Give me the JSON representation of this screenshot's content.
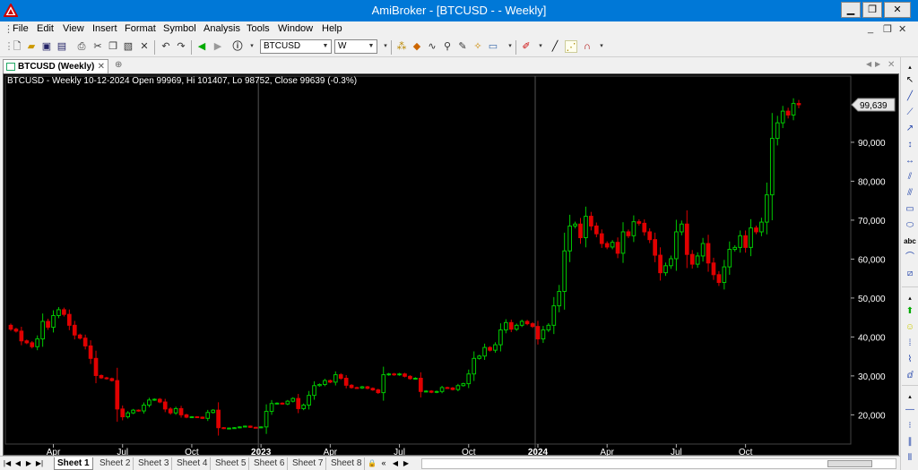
{
  "window": {
    "title": "AmiBroker - [BTCUSD -  - Weekly]",
    "minimize_label": "▁",
    "restore_label": "❐",
    "close_label": "✕"
  },
  "menu": {
    "items": [
      "File",
      "Edit",
      "View",
      "Insert",
      "Format",
      "Symbol",
      "Analysis",
      "Tools",
      "Window",
      "Help"
    ],
    "mdi_min": "_",
    "mdi_restore": "❐",
    "mdi_close": "✕"
  },
  "toolbar": {
    "symbol_value": "BTCUSD",
    "interval_value": "W"
  },
  "chart_tab": {
    "label": "BTCUSD (Weekly)",
    "close_label": "✕"
  },
  "info_line": "BTCUSD - Weekly 10-12-2024 Open 99969, Hi 101407, Lo 98752, Close 99639 (-0.3%)",
  "colors": {
    "up": "#00c800",
    "down": "#e00000",
    "background": "#000000",
    "axis_text": "#ffffff"
  },
  "sheets": [
    "Sheet 1",
    "Sheet 2",
    "Sheet 3",
    "Sheet 4",
    "Sheet 5",
    "Sheet 6",
    "Sheet 7",
    "Sheet 8"
  ],
  "chart_data": {
    "type": "candlestick",
    "symbol": "BTCUSD",
    "interval": "Weekly",
    "ylim": [
      12500,
      107000
    ],
    "y_ticks": [
      20000,
      30000,
      40000,
      50000,
      60000,
      70000,
      80000,
      90000
    ],
    "y_tick_labels": [
      "20,000",
      "30,000",
      "40,000",
      "50,000",
      "60,000",
      "70,000",
      "80,000",
      "90,000"
    ],
    "last_close_label": "99,639",
    "last_close": 99639,
    "x_labels": [
      {
        "week": 8,
        "label": "Apr",
        "bold": false
      },
      {
        "week": 21,
        "label": "Jul",
        "bold": false
      },
      {
        "week": 34,
        "label": "Oct",
        "bold": false
      },
      {
        "week": 47,
        "label": "2023",
        "bold": true
      },
      {
        "week": 60,
        "label": "Apr",
        "bold": false
      },
      {
        "week": 73,
        "label": "Jul",
        "bold": false
      },
      {
        "week": 86,
        "label": "Oct",
        "bold": false
      },
      {
        "week": 99,
        "label": "2024",
        "bold": true
      },
      {
        "week": 112,
        "label": "Apr",
        "bold": false
      },
      {
        "week": 125,
        "label": "Jul",
        "bold": false
      },
      {
        "week": 138,
        "label": "Oct",
        "bold": false
      }
    ],
    "year_dividers": [
      47,
      99
    ],
    "close": [
      42000,
      41500,
      39000,
      38500,
      37500,
      39500,
      44000,
      42500,
      45500,
      47000,
      45800,
      43000,
      40500,
      39700,
      37700,
      34500,
      30100,
      29500,
      29300,
      28800,
      21500,
      19500,
      20500,
      21200,
      21000,
      22500,
      23800,
      24000,
      23300,
      21500,
      20500,
      21600,
      20000,
      19400,
      19500,
      19400,
      19100,
      20600,
      21200,
      16700,
      16500,
      16600,
      16700,
      16900,
      17100,
      16800,
      16700,
      16900,
      20900,
      22900,
      23000,
      22800,
      23500,
      24200,
      21600,
      22500,
      25000,
      27500,
      27800,
      28800,
      28400,
      30300,
      29400,
      27600,
      27000,
      26900,
      27200,
      26800,
      26400,
      25700,
      30300,
      30500,
      30300,
      30500,
      29900,
      29300,
      29400,
      26000,
      26100,
      25800,
      26000,
      27000,
      26900,
      26500,
      27500,
      28000,
      30500,
      34500,
      35100,
      37300,
      36600,
      38000,
      41800,
      43700,
      42000,
      43000,
      44000,
      43400,
      42700,
      39500,
      41800,
      43000,
      48000,
      51700,
      62100,
      68500,
      69000,
      65500,
      71000,
      68500,
      66500,
      64000,
      63100,
      64300,
      61500,
      67000,
      66000,
      69600,
      69200,
      67000,
      65000,
      61000,
      56500,
      58300,
      60100,
      67000,
      69000,
      61200,
      58700,
      60800,
      64000,
      59000,
      56000,
      54000,
      58000,
      62500,
      63000,
      66000,
      63000,
      68000,
      67000,
      69500,
      76500,
      91000,
      95000,
      98000,
      97000,
      99969,
      99639
    ],
    "open_first": 43000
  }
}
